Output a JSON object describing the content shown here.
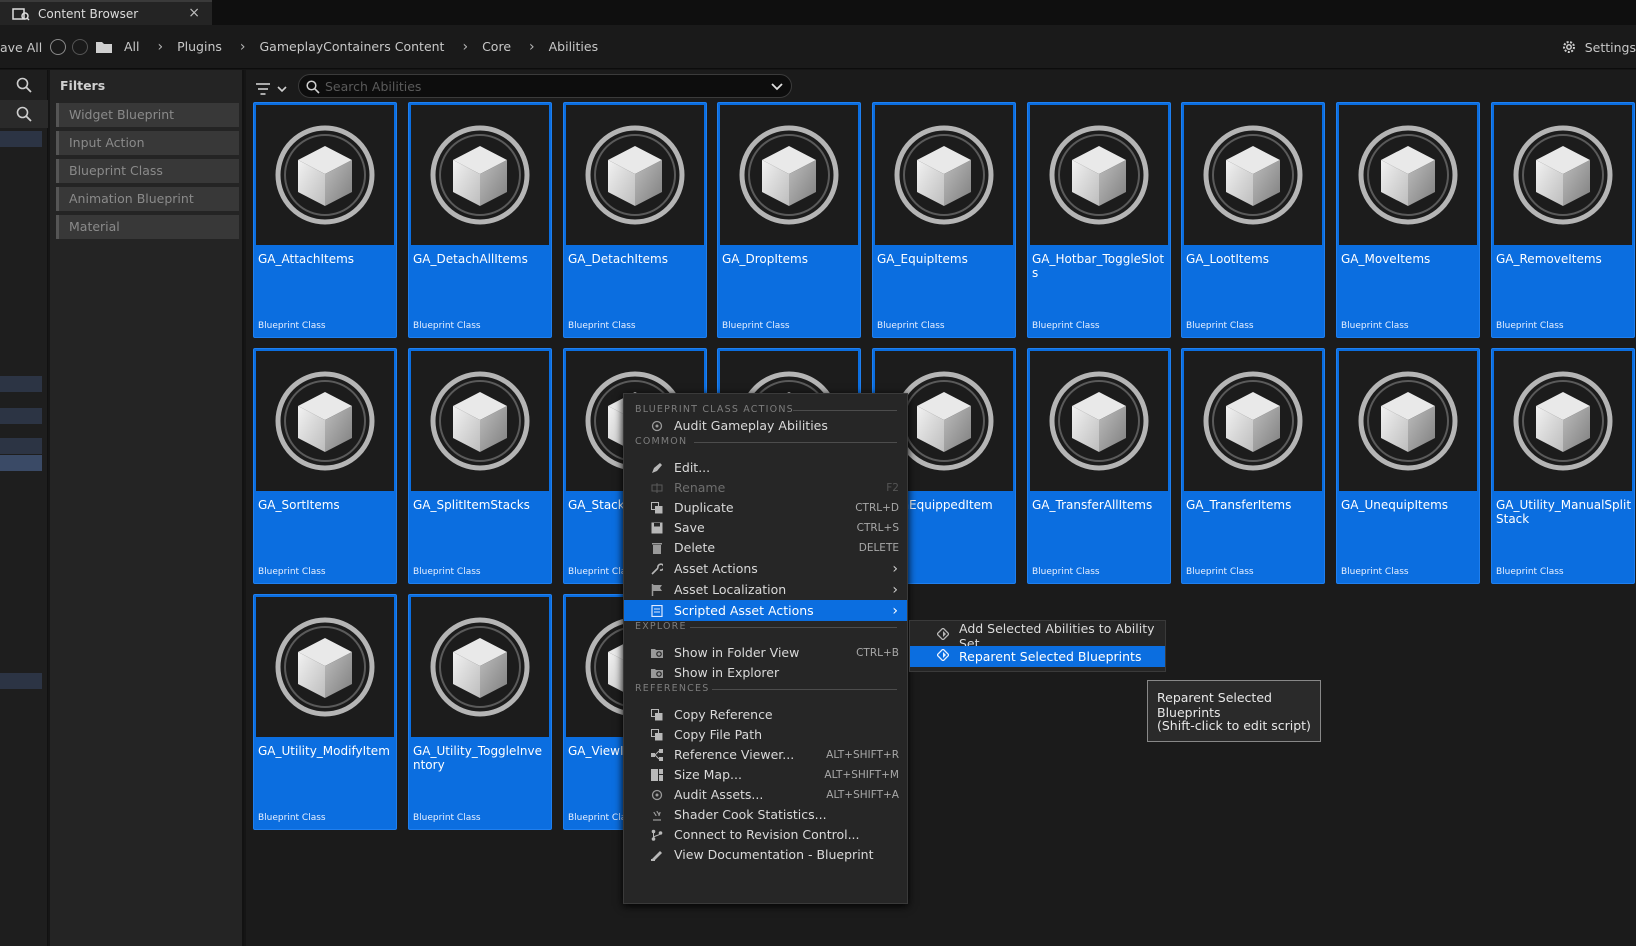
{
  "tab": {
    "title": "Content Browser",
    "close": "×"
  },
  "toolbar": {
    "save_all": "ave All",
    "breadcrumbs": [
      "All",
      "Plugins",
      "GameplayContainers Content",
      "Core",
      "Abilities"
    ],
    "separator": "›",
    "settings_label": "Settings"
  },
  "filters": {
    "title": "Filters",
    "items": [
      "Widget Blueprint",
      "Input Action",
      "Blueprint Class",
      "Animation Blueprint",
      "Material"
    ]
  },
  "search": {
    "placeholder": "Search Abilities"
  },
  "assets": [
    {
      "name": "GA_AttachItems",
      "type": "Blueprint Class"
    },
    {
      "name": "GA_DetachAllItems",
      "type": "Blueprint Class"
    },
    {
      "name": "GA_DetachItems",
      "type": "Blueprint Class"
    },
    {
      "name": "GA_DropItems",
      "type": "Blueprint Class"
    },
    {
      "name": "GA_EquipItems",
      "type": "Blueprint Class"
    },
    {
      "name": "GA_Hotbar_ToggleSlots",
      "type": "Blueprint Class"
    },
    {
      "name": "GA_LootItems",
      "type": "Blueprint Class"
    },
    {
      "name": "GA_MoveItems",
      "type": "Blueprint Class"
    },
    {
      "name": "GA_RemoveItems",
      "type": "Blueprint Class"
    },
    {
      "name": "GA_SortItems",
      "type": "Blueprint Class"
    },
    {
      "name": "GA_SplitItemStacks",
      "type": "Blueprint Class"
    },
    {
      "name": "GA_StackIt",
      "type": "Blueprint Class"
    },
    {
      "name": "",
      "type": ""
    },
    {
      "name": "witchEquippedItem",
      "type": "Class"
    },
    {
      "name": "GA_TransferAllItems",
      "type": "Blueprint Class"
    },
    {
      "name": "GA_TransferItems",
      "type": "Blueprint Class"
    },
    {
      "name": "GA_UnequipItems",
      "type": "Blueprint Class"
    },
    {
      "name": "GA_Utility_ManualSplitStack",
      "type": "Blueprint Class"
    },
    {
      "name": "GA_Utility_ModifyItem",
      "type": "Blueprint Class"
    },
    {
      "name": "GA_Utility_ToggleInventory",
      "type": "Blueprint Class"
    },
    {
      "name": "GA_ViewIte",
      "type": "Blueprint Class"
    }
  ],
  "context_menu": {
    "sections": {
      "blueprint": "BLUEPRINT CLASS ACTIONS",
      "common": "COMMON",
      "explore": "EXPLORE",
      "references": "REFERENCES"
    },
    "items": {
      "audit_gameplay": {
        "label": "Audit Gameplay Abilities",
        "shortcut": ""
      },
      "edit": {
        "label": "Edit...",
        "shortcut": ""
      },
      "rename": {
        "label": "Rename",
        "shortcut": "F2"
      },
      "duplicate": {
        "label": "Duplicate",
        "shortcut": "CTRL+D"
      },
      "save": {
        "label": "Save",
        "shortcut": "CTRL+S"
      },
      "delete": {
        "label": "Delete",
        "shortcut": "DELETE"
      },
      "asset_actions": {
        "label": "Asset Actions",
        "shortcut": "›"
      },
      "asset_localization": {
        "label": "Asset Localization",
        "shortcut": "›"
      },
      "scripted_asset_actions": {
        "label": "Scripted Asset Actions",
        "shortcut": "›"
      },
      "show_folder": {
        "label": "Show in Folder View",
        "shortcut": "CTRL+B"
      },
      "show_explorer": {
        "label": "Show in Explorer",
        "shortcut": ""
      },
      "copy_reference": {
        "label": "Copy Reference",
        "shortcut": ""
      },
      "copy_file_path": {
        "label": "Copy File Path",
        "shortcut": ""
      },
      "reference_viewer": {
        "label": "Reference Viewer...",
        "shortcut": "ALT+SHIFT+R"
      },
      "size_map": {
        "label": "Size Map...",
        "shortcut": "ALT+SHIFT+M"
      },
      "audit_assets": {
        "label": "Audit Assets...",
        "shortcut": "ALT+SHIFT+A"
      },
      "shader_cook": {
        "label": "Shader Cook Statistics...",
        "shortcut": ""
      },
      "revision_control": {
        "label": "Connect to Revision Control...",
        "shortcut": ""
      },
      "view_docs": {
        "label": "View Documentation - Blueprint",
        "shortcut": ""
      }
    }
  },
  "submenu": {
    "items": [
      "Add Selected Abilities to Ability Set",
      "Reparent Selected Blueprints"
    ]
  },
  "tooltip": {
    "line1": "Reparent Selected Blueprints",
    "line2": "(Shift-click to edit script)"
  },
  "colors": {
    "accent": "#0b6ee0",
    "panel": "#242424",
    "background": "#1b1b1b"
  }
}
